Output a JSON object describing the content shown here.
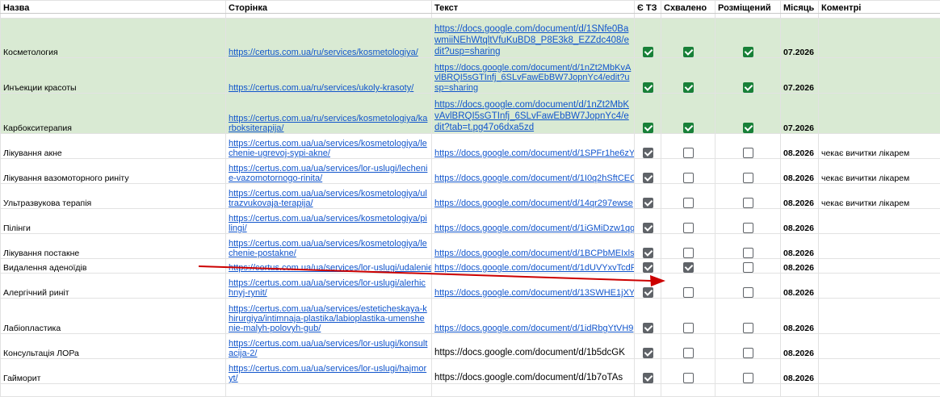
{
  "headers": {
    "name": "Назва",
    "page": "Сторінка",
    "text": "Текст",
    "has_tz": "Є ТЗ",
    "approved": "Схвалено",
    "placed": "Розміщений",
    "month": "Місяць",
    "comments": "Коментрі"
  },
  "rows": [
    {
      "name": "Косметология",
      "page": "https://certus.com.ua/ru/services/kosmetologiya/",
      "text": "https://docs.google.com/document/d/1SNfe0BawmiiNEhWtqltVfuKuBD8_P8E3k8_EZZdc408/edit?usp=sharing",
      "tz": true,
      "approved": true,
      "placed": true,
      "month": "07.2026",
      "comment": ""
    },
    {
      "name": "Инъекции красоты",
      "page": "https://certus.com.ua/ru/services/ukoly-krasoty/",
      "text": "https://docs.google.com/document/d/1nZt2MbKvAvlBRQI5sGTInfj_6SLvFawEbBW7JopnYc4/edit?usp=sharing",
      "tz": true,
      "approved": true,
      "placed": true,
      "month": "07.2026",
      "comment": ""
    },
    {
      "name": "Карбокситерапия",
      "page": "https://certus.com.ua/ru/services/kosmetologiya/karboksiterapija/",
      "text": "https://docs.google.com/document/d/1nZt2MbKvAvlBRQI5sGTInfj_6SLvFawEbBW7JopnYc4/edit?tab=t.pg47o6dxa5zd",
      "tz": true,
      "approved": true,
      "placed": true,
      "month": "07.2026",
      "comment": ""
    },
    {
      "name": "Лікування акне",
      "page": "https://certus.com.ua/ua/services/kosmetologiya/lechenie-ugrevoj-sypi-akne/",
      "text": "https://docs.google.com/document/d/1SPFr1he6zY",
      "tz": true,
      "approved": false,
      "placed": false,
      "month": "08.2026",
      "comment": "чекає вичитки лікарем"
    },
    {
      "name": "Лікування вазомоторного риніту",
      "page": "https://certus.com.ua/ua/services/lor-uslugi/lechenie-vazomotornogo-rinita/",
      "text": "https://docs.google.com/document/d/1I0q2hSftCEC",
      "tz": true,
      "approved": false,
      "placed": false,
      "month": "08.2026",
      "comment": "чекає вичитки лікарем"
    },
    {
      "name": "Ультразвукова терапія",
      "page": "https://certus.com.ua/ua/services/kosmetologiya/ultrazvukovaja-terapija/",
      "text": "https://docs.google.com/document/d/14qr297ewse",
      "tz": true,
      "approved": false,
      "placed": false,
      "month": "08.2026",
      "comment": "чекає вичитки лікарем"
    },
    {
      "name": "Пілінги",
      "page": "https://certus.com.ua/ua/services/kosmetologiya/pilingi/",
      "text": "https://docs.google.com/document/d/1iGMiDzw1qq",
      "tz": true,
      "approved": false,
      "placed": false,
      "month": "08.2026",
      "comment": ""
    },
    {
      "name": "Лікування постакне",
      "page": "https://certus.com.ua/ua/services/kosmetologiya/lechenie-postakne/",
      "text": "https://docs.google.com/document/d/1BCPbMEIxls",
      "tz": true,
      "approved": false,
      "placed": false,
      "month": "08.2026",
      "comment": ""
    },
    {
      "name": "Видалення аденоїдів",
      "page": "https://certus.com.ua/ua/services/lor-uslugi/udalenie",
      "text": "https://docs.google.com/document/d/1dUVYxvTcdF",
      "tz": true,
      "approved": true,
      "placed": false,
      "month": "08.2026",
      "comment": ""
    },
    {
      "name": "Алергічний риніт",
      "page": "https://certus.com.ua/ua/services/lor-uslugi/alerhichnyj-rynit/",
      "text": "https://docs.google.com/document/d/13SWHE1jXY",
      "tz": true,
      "approved": false,
      "placed": false,
      "month": "08.2026",
      "comment": ""
    },
    {
      "name": "Лабіопластика",
      "page": "https://certus.com.ua/ua/services/esteticheskaya-khirurgiya/intimnaja-plastika/labioplastika-umenshenie-malyh-polovyh-gub/",
      "text": "https://docs.google.com/document/d/1idRbgYtVH9",
      "tz": true,
      "approved": false,
      "placed": false,
      "month": "08.2026",
      "comment": ""
    },
    {
      "name": "Консультація ЛОРа",
      "page": "https://certus.com.ua/ua/services/lor-uslugi/konsultacija-2/",
      "text": "https://docs.google.com/document/d/1b5dcGK",
      "tz": true,
      "approved": false,
      "placed": false,
      "month": "08.2026",
      "comment": ""
    },
    {
      "name": "Гайморит",
      "page": "https://certus.com.ua/ua/services/lor-uslugi/hajmoryt/",
      "text": "https://docs.google.com/document/d/1b7oTAs",
      "tz": true,
      "approved": false,
      "placed": false,
      "month": "08.2026",
      "comment": ""
    }
  ],
  "colors": {
    "approved_row_bg": "#d9ead3",
    "checkbox_green": "#188038",
    "checkbox_gray": "#5f6368",
    "link": "#1155cc",
    "arrow": "#cc0000"
  }
}
